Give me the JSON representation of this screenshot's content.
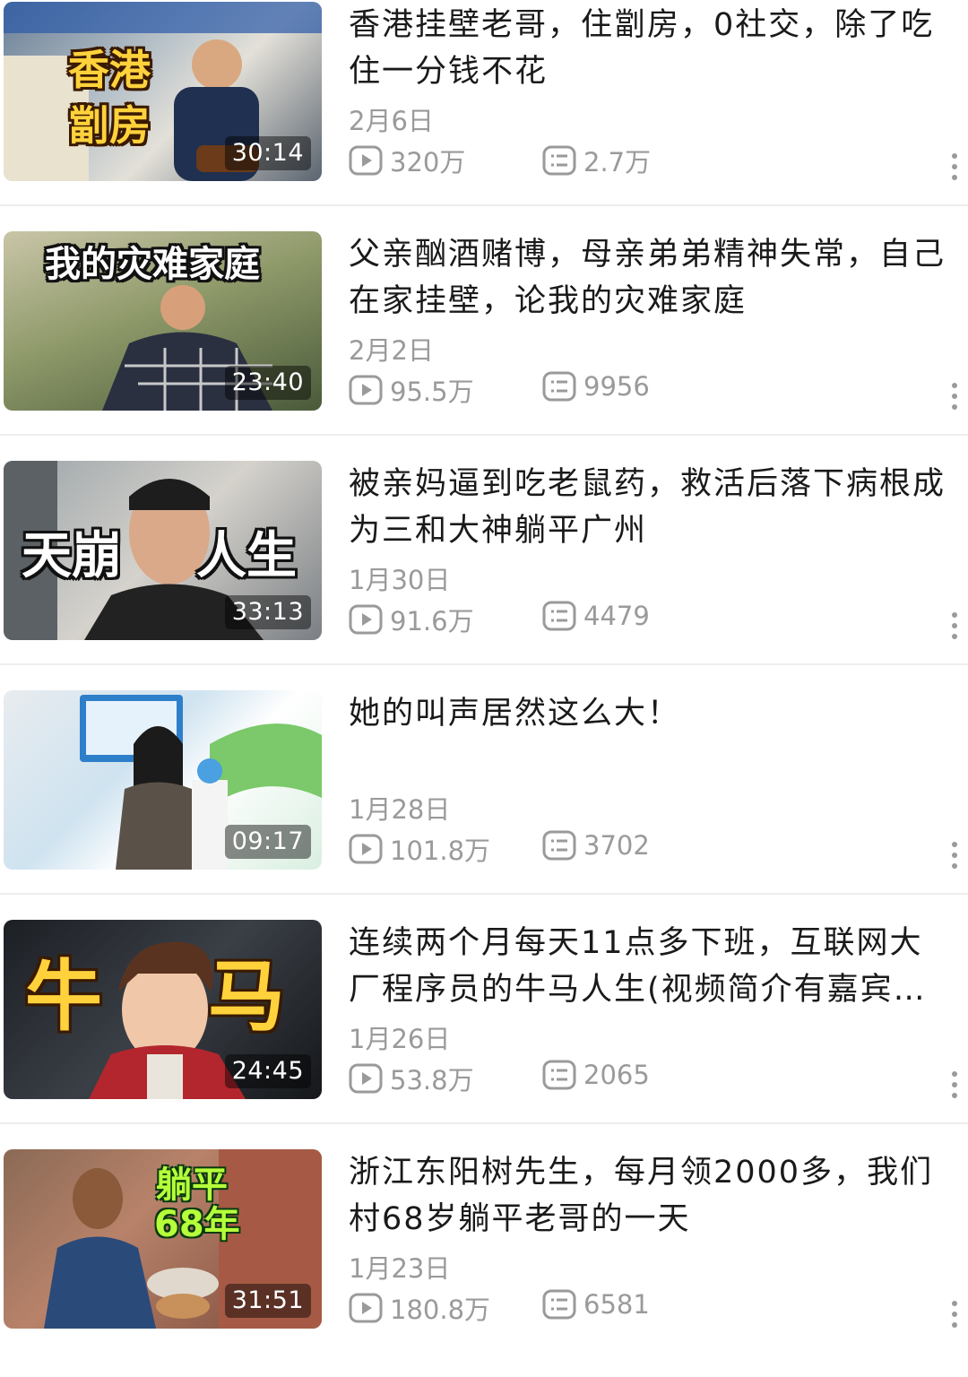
{
  "videos": [
    {
      "title": "香港挂壁老哥，住劏房，0社交，除了吃住一分钱不花",
      "date": "2月6日",
      "views": "320万",
      "danmaku": "2.7万",
      "duration": "30:14",
      "thumb_caption": [
        "香港",
        "劏房"
      ]
    },
    {
      "title": "父亲酗酒赌博，母亲弟弟精神失常，自己在家挂壁，论我的灾难家庭",
      "date": "2月2日",
      "views": "95.5万",
      "danmaku": "9956",
      "duration": "23:40",
      "thumb_caption": "我的灾难家庭"
    },
    {
      "title": "被亲妈逼到吃老鼠药，救活后落下病根成为三和大神躺平广州",
      "date": "1月30日",
      "views": "91.6万",
      "danmaku": "4479",
      "duration": "33:13",
      "thumb_caption": [
        "天崩",
        "人生"
      ]
    },
    {
      "title": "她的叫声居然这么大！",
      "date": "1月28日",
      "views": "101.8万",
      "danmaku": "3702",
      "duration": "09:17"
    },
    {
      "title": "连续两个月每天11点多下班，互联网大厂程序员的牛马人生(视频简介有嘉宾…",
      "date": "1月26日",
      "views": "53.8万",
      "danmaku": "2065",
      "duration": "24:45",
      "thumb_caption": [
        "牛",
        "马"
      ]
    },
    {
      "title": "浙江东阳树先生，每月领2000多，我们村68岁躺平老哥的一天",
      "date": "1月23日",
      "views": "180.8万",
      "danmaku": "6581",
      "duration": "31:51",
      "thumb_caption": [
        "躺平",
        "68年"
      ]
    }
  ],
  "icons": {
    "play": "play-count-icon",
    "danmaku": "danmaku-icon",
    "more": "more-vertical-icon"
  },
  "colors": {
    "meta_gray": "#9a9a9a",
    "title": "#1a1a1a",
    "divider": "#eeeeee"
  }
}
